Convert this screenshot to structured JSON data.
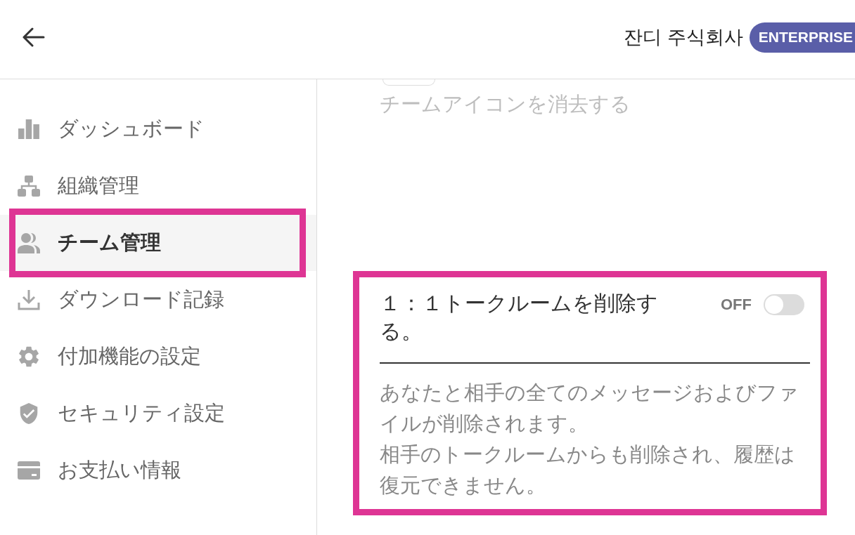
{
  "header": {
    "company_name": "잔디 주식회사",
    "plan_badge": "ENTERPRISE"
  },
  "sidebar": {
    "items": [
      {
        "kind": "dashboard",
        "label": "ダッシュボード",
        "selected": false,
        "highlighted": false
      },
      {
        "kind": "organization",
        "label": "組織管理",
        "selected": false,
        "highlighted": false
      },
      {
        "kind": "team",
        "label": "チーム管理",
        "selected": true,
        "highlighted": true
      },
      {
        "kind": "download",
        "label": "ダウンロード記録",
        "selected": false,
        "highlighted": false
      },
      {
        "kind": "addon",
        "label": "付加機能の設定",
        "selected": false,
        "highlighted": false
      },
      {
        "kind": "security",
        "label": "セキュリティ設定",
        "selected": false,
        "highlighted": false
      },
      {
        "kind": "billing",
        "label": "お支払い情報",
        "selected": false,
        "highlighted": false
      }
    ]
  },
  "content": {
    "remove_icon_action": {
      "label": "チームアイコンを消去する",
      "disabled": true
    },
    "setting_card": {
      "highlighted": true,
      "title": "１：１トークルームを削除する。",
      "toggle": {
        "label": "OFF",
        "on": false
      },
      "description": [
        "あなたと相手の全てのメッセージおよびファイルが削除されます。",
        "相手のトークルームからも削除され、履歴は復元できません。"
      ]
    }
  }
}
